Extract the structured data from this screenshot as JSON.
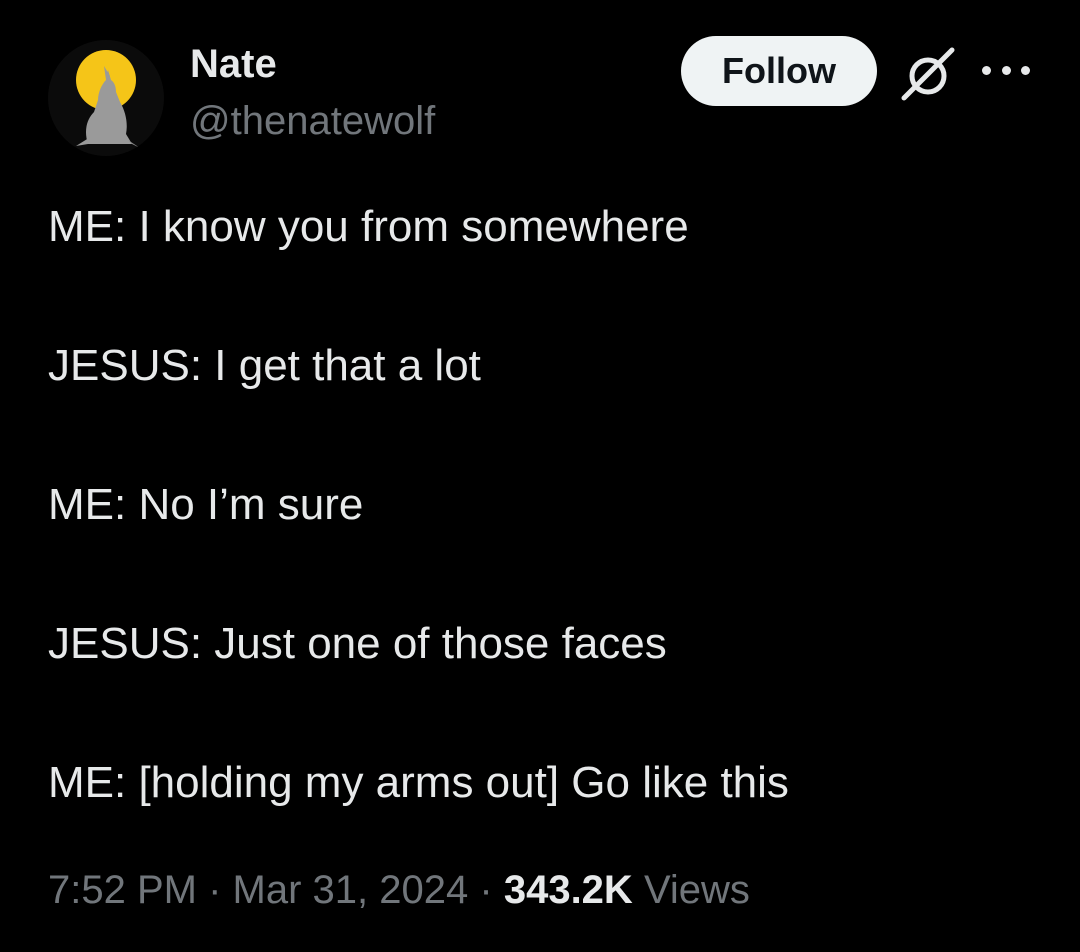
{
  "author": {
    "name": "Nate",
    "handle": "@thenatewolf",
    "avatar_icon": "howling-wolf-moon-icon"
  },
  "actions": {
    "follow_label": "Follow",
    "grok_icon": "grok-icon",
    "more_icon": "more-options-icon"
  },
  "tweet": {
    "lines": [
      "ME: I know you from somewhere",
      "JESUS: I get that a lot",
      "ME: No I’m sure",
      "JESUS: Just one of those faces",
      "ME: [holding my arms out] Go like this"
    ]
  },
  "meta": {
    "time": "7:52 PM",
    "separator": "·",
    "date": "Mar 31, 2024",
    "views_count": "343.2K",
    "views_label": "Views"
  },
  "colors": {
    "background": "#000000",
    "text_primary": "#e7e9ea",
    "text_secondary": "#71767b",
    "follow_bg": "#eff3f4",
    "moon": "#f5c518"
  }
}
